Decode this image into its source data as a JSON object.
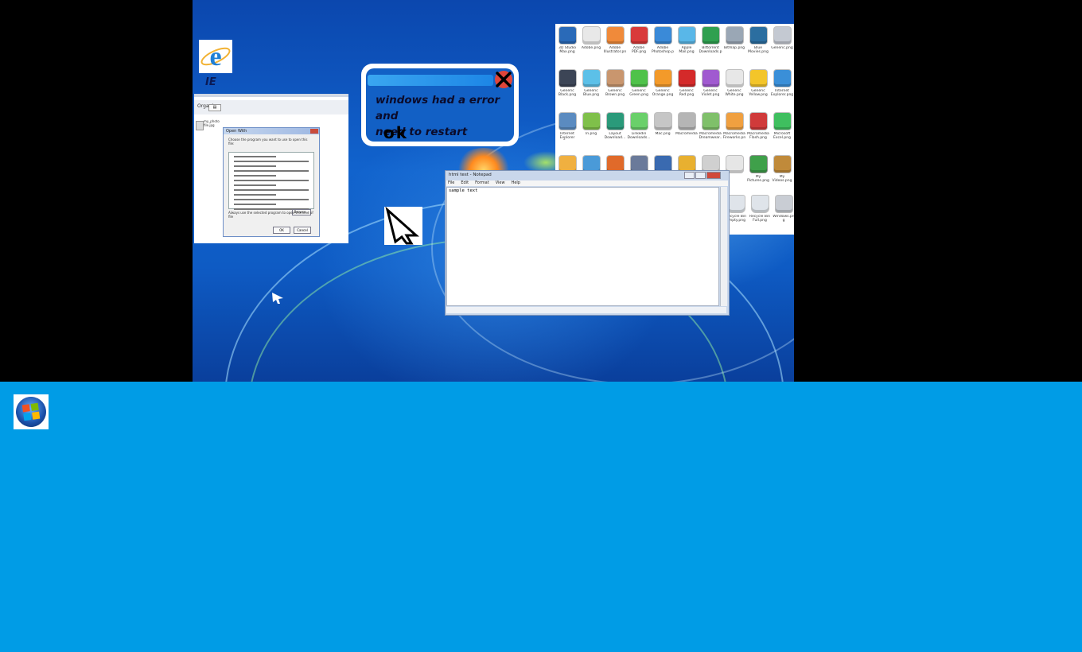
{
  "ie_shortcut": {
    "label": "IE",
    "icon": "ie-icon"
  },
  "error_dialog": {
    "message_line1": "windows had a error and",
    "message_line2": "need to restart",
    "ok_label": "ok",
    "close_icon": "close-icon"
  },
  "open_with_window": {
    "toolbar_label": "Organize",
    "browse_label": "Browse...",
    "file_label": "my_photo file.jpg",
    "dialog_title": "Open With",
    "dialog_text": "Choose the program you want to use to open this file:",
    "checkbox_text": "Always use the selected program to open this kind of file",
    "ok_label": "OK",
    "cancel_label": "Cancel"
  },
  "notepad": {
    "title": "html test - Notepad",
    "menu": [
      "File",
      "Edit",
      "Format",
      "View",
      "Help"
    ],
    "content": "sample text"
  },
  "icons": [
    [
      "3D Studio Max.png",
      "Adobe.png",
      "Adobe Illustrator.png",
      "Adobe PDF.png",
      "Adobe Photoshop.png",
      "Apple Mail.png",
      "Bittorrent Downloads.png",
      "Bitmap.png",
      "Blue Movies.png",
      "Generic.png"
    ],
    [
      "Generic Black.png",
      "Generic Blue.png",
      "Generic Brown.png",
      "Generic Green.png",
      "Generic Orange.png",
      "Generic Red.png",
      "Generic Violet.png",
      "Generic White.png",
      "Generic Yellow.png",
      "Internet Explorer.png"
    ],
    [
      "Internet Explorer Bu...",
      "In.png",
      "Layout Download...",
      "Linkedin Downloads...",
      "Mac.png",
      "Macromedia",
      "Macromedia Dreamwear...",
      "Macromedia Fireworks.png",
      "Macromedia Flash.png",
      "Microsoft Excel.png"
    ]
  ],
  "icons_row4": [
    "",
    "",
    "",
    "",
    "",
    "",
    "",
    "",
    "",
    "My Pictures.png",
    "My Videos.png"
  ],
  "icons_row5": [
    "Recycle Bin Empty.png",
    "Recycle Bin Full.png",
    "Windows.png"
  ],
  "colors": {
    "taskbar": "#009ce6",
    "desktop": "#1163cd"
  },
  "taskbar": {
    "start_icon": "windows-start-orb-icon"
  }
}
